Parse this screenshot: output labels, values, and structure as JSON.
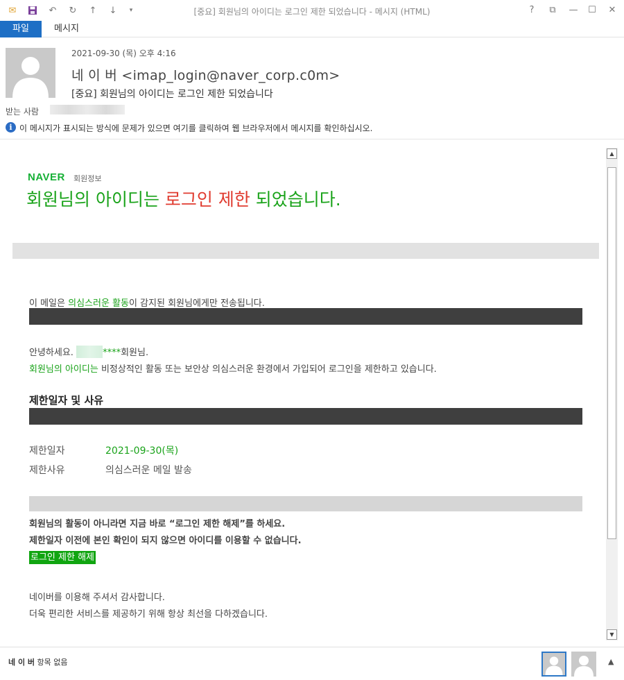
{
  "window": {
    "title": "[중요] 회원님의 아이디는 로그인 제한 되었습니다 - 메시지 (HTML)",
    "help": "?",
    "restore": "⧉",
    "maximize": "☐",
    "close": "✕"
  },
  "quick_access": {
    "mail": "✉",
    "save": "💾",
    "undo": "↶",
    "redo": "↻",
    "prev": "↑",
    "next": "↓",
    "customize": "▾"
  },
  "ribbon": {
    "tabs": [
      "파일",
      "메시지"
    ]
  },
  "header": {
    "date": "2021-09-30 (목) 오후 4:16",
    "from": "네 이 버 <imap_login@naver_corp.c0m>",
    "subject": "[중요] 회원님의 아이디는 로그인 제한 되었습니다",
    "to_label": "받는 사람",
    "info": "이 메시지가 표시되는 방식에 문제가 있으면 여기를 클릭하여 웹 브라우저에서 메시지를 확인하십시오.",
    "info_icon": "i"
  },
  "email": {
    "logo": "NAVER",
    "logo_sub": "회원정보",
    "headline_a": "회원님의 아이디는 ",
    "headline_b": "로그인 제한",
    "headline_c": " 되었습니다.",
    "notice_a": "이 메일은 ",
    "notice_b": "의심스러운 활동",
    "notice_c": "이 감지된 회원님에게만 전송됩니다.",
    "greeting_a": "안녕하세요. ",
    "greeting_b": "****",
    "greeting_c": "회원님.",
    "desc_a": "회원님의 아이디는",
    "desc_b": " 비정상적인 활동 또는 보안상 의심스러운 환경에서 가입되어 로그인을 제한하고 있습니다.",
    "section_title": "제한일자 및 사유",
    "date_label": "제한일자",
    "date_value": "2021-09-30(목)",
    "reason_label": "제한사유",
    "reason_value": "의심스러운 메일 발송",
    "warn1": "회원님의 활동이 아니라면 지금 바로 “로그인 제한 해제”를 하세요.",
    "warn2": "제한일자 이전에 본인 확인이 되지 않으면 아이디를 이용할 수 없습니다.",
    "unlock_button": "로그인 제한 해제",
    "thanks1": "네이버를 이용해 주셔서 감사합니다.",
    "thanks2": "더욱 편리한 서비스를 제공하기 위해 항상 최선을 다하겠습니다."
  },
  "scrollbar": {
    "up": "▲",
    "down": "▼"
  },
  "footer": {
    "sender": "네 이 버",
    "status": " 항목 없음",
    "caret": "▲"
  },
  "colors": {
    "accent": "#1e6fc5",
    "naver_green": "#16b036",
    "headline_green": "#1aa31a",
    "headline_red": "#e03b2f",
    "button_green": "#10a510"
  }
}
